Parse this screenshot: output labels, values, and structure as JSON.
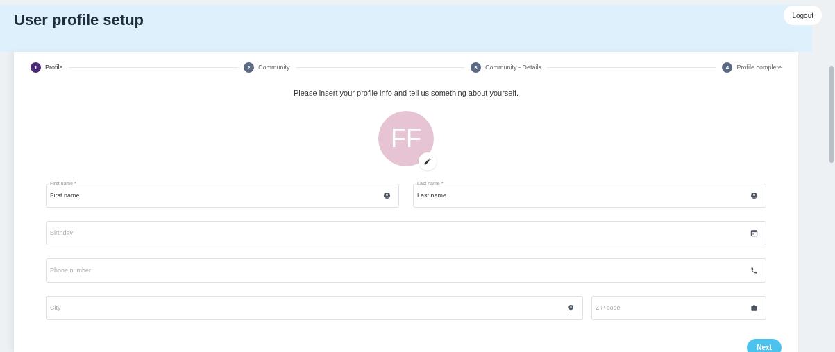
{
  "header": {
    "title": "User profile setup",
    "logout_button": "Logout"
  },
  "steps": [
    {
      "number": "1",
      "label": "Profile",
      "selected": true
    },
    {
      "number": "2",
      "label": "Community",
      "selected": false
    },
    {
      "number": "3",
      "label": "Community - Details",
      "selected": false
    },
    {
      "number": "4",
      "label": "Profile complete",
      "selected": false
    }
  ],
  "intro": "Please insert your profile info and tell us something about yourself.",
  "avatar": {
    "initials": "FF"
  },
  "field_rows": [
    [
      {
        "label": "First name *",
        "value": "First name"
      },
      {
        "label": "Last name *",
        "value": "Last name"
      }
    ],
    [
      {
        "placeholder": "Birthday"
      }
    ],
    [
      {
        "placeholder": "Phone number"
      }
    ],
    [
      {
        "placeholder": "City"
      },
      {
        "placeholder": "ZIP code"
      }
    ]
  ],
  "next_button": "Next"
}
